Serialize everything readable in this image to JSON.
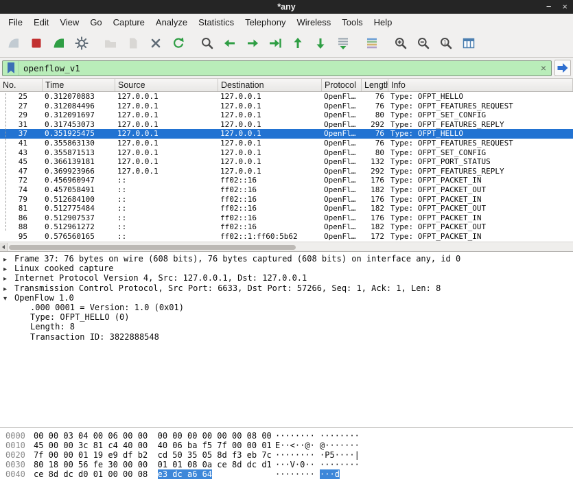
{
  "window": {
    "title": "*any",
    "minimize_glyph": "−",
    "close_glyph": "×"
  },
  "colors": {
    "accent_selection": "#2273d2",
    "hex_highlight": "#3d87d9",
    "filter_valid_green": "#b9edb9",
    "titlebar_bg": "#252525",
    "stop_red": "#c23030",
    "nav_green": "#2f9e44"
  },
  "menu": {
    "items": [
      "File",
      "Edit",
      "View",
      "Go",
      "Capture",
      "Analyze",
      "Statistics",
      "Telephony",
      "Wireless",
      "Tools",
      "Help"
    ]
  },
  "toolbar": {
    "buttons": [
      {
        "name": "capture-start",
        "icon": "fin",
        "color": "#7e96a8",
        "disabled": true
      },
      {
        "name": "capture-stop",
        "icon": "square",
        "color": "#c23030",
        "disabled": false
      },
      {
        "name": "capture-restart",
        "icon": "fin",
        "color": "#2f9e44",
        "disabled": false
      },
      {
        "name": "capture-options",
        "icon": "gear",
        "color": "#5f6b76",
        "disabled": false
      },
      {
        "sep": true
      },
      {
        "name": "open-file",
        "icon": "folder",
        "color": "#b7b3ad",
        "disabled": true
      },
      {
        "name": "save-file",
        "icon": "doc",
        "color": "#b7b3ad",
        "disabled": true
      },
      {
        "name": "close-file",
        "icon": "close",
        "color": "#5f6b76",
        "disabled": false
      },
      {
        "name": "reload-file",
        "icon": "reload",
        "color": "#2f9e44",
        "disabled": false
      },
      {
        "sep": true
      },
      {
        "name": "find-packet",
        "icon": "magnifier",
        "color": "#4a4a4a",
        "disabled": false
      },
      {
        "name": "go-back",
        "icon": "arrow-left",
        "color": "#2f9e44",
        "disabled": false
      },
      {
        "name": "go-forward",
        "icon": "arrow-right",
        "color": "#2f9e44",
        "disabled": false
      },
      {
        "name": "go-to-packet",
        "icon": "goto",
        "color": "#2f9e44",
        "disabled": false
      },
      {
        "name": "go-first",
        "icon": "arrow-top",
        "color": "#2f9e44",
        "disabled": false
      },
      {
        "name": "go-last",
        "icon": "arrow-bottom",
        "color": "#2f9e44",
        "disabled": false
      },
      {
        "name": "auto-scroll",
        "icon": "autoscroll",
        "color": "#2f9e44",
        "disabled": false
      },
      {
        "sep": true
      },
      {
        "name": "colorize",
        "icon": "colorize",
        "color": "#7a8ea0",
        "disabled": false
      },
      {
        "sep": true
      },
      {
        "name": "zoom-in",
        "icon": "zoom-in",
        "color": "#4a4a4a",
        "disabled": false
      },
      {
        "name": "zoom-out",
        "icon": "zoom-out",
        "color": "#4a4a4a",
        "disabled": false
      },
      {
        "name": "zoom-original",
        "icon": "zoom-orig",
        "color": "#4a4a4a",
        "disabled": false
      },
      {
        "name": "resize-columns",
        "icon": "columns",
        "color": "#4c7fb0",
        "disabled": false
      }
    ]
  },
  "filter": {
    "value": "openflow_v1",
    "clear_glyph": "×"
  },
  "packet_list": {
    "columns": [
      "No.",
      "Time",
      "Source",
      "Destination",
      "Protocol",
      "Length",
      "Info"
    ],
    "rows": [
      {
        "no": "25",
        "time": "0.312070883",
        "src": "127.0.0.1",
        "dst": "127.0.0.1",
        "proto": "OpenFl…",
        "len": "76",
        "info": "Type: OFPT_HELLO",
        "selected": false
      },
      {
        "no": "27",
        "time": "0.312084496",
        "src": "127.0.0.1",
        "dst": "127.0.0.1",
        "proto": "OpenFl…",
        "len": "76",
        "info": "Type: OFPT_FEATURES_REQUEST",
        "selected": false
      },
      {
        "no": "29",
        "time": "0.312091697",
        "src": "127.0.0.1",
        "dst": "127.0.0.1",
        "proto": "OpenFl…",
        "len": "80",
        "info": "Type: OFPT_SET_CONFIG",
        "selected": false
      },
      {
        "no": "31",
        "time": "0.317453073",
        "src": "127.0.0.1",
        "dst": "127.0.0.1",
        "proto": "OpenFl…",
        "len": "292",
        "info": "Type: OFPT_FEATURES_REPLY",
        "selected": false
      },
      {
        "no": "37",
        "time": "0.351925475",
        "src": "127.0.0.1",
        "dst": "127.0.0.1",
        "proto": "OpenFl…",
        "len": "76",
        "info": "Type: OFPT_HELLO",
        "selected": true
      },
      {
        "no": "41",
        "time": "0.355863130",
        "src": "127.0.0.1",
        "dst": "127.0.0.1",
        "proto": "OpenFl…",
        "len": "76",
        "info": "Type: OFPT_FEATURES_REQUEST",
        "selected": false
      },
      {
        "no": "43",
        "time": "0.355871513",
        "src": "127.0.0.1",
        "dst": "127.0.0.1",
        "proto": "OpenFl…",
        "len": "80",
        "info": "Type: OFPT_SET_CONFIG",
        "selected": false
      },
      {
        "no": "45",
        "time": "0.366139181",
        "src": "127.0.0.1",
        "dst": "127.0.0.1",
        "proto": "OpenFl…",
        "len": "132",
        "info": "Type: OFPT_PORT_STATUS",
        "selected": false
      },
      {
        "no": "47",
        "time": "0.369923966",
        "src": "127.0.0.1",
        "dst": "127.0.0.1",
        "proto": "OpenFl…",
        "len": "292",
        "info": "Type: OFPT_FEATURES_REPLY",
        "selected": false
      },
      {
        "no": "72",
        "time": "0.456960947",
        "src": "::",
        "dst": "ff02::16",
        "proto": "OpenFl…",
        "len": "176",
        "info": "Type: OFPT_PACKET_IN",
        "selected": false
      },
      {
        "no": "74",
        "time": "0.457058491",
        "src": "::",
        "dst": "ff02::16",
        "proto": "OpenFl…",
        "len": "182",
        "info": "Type: OFPT_PACKET_OUT",
        "selected": false
      },
      {
        "no": "79",
        "time": "0.512684100",
        "src": "::",
        "dst": "ff02::16",
        "proto": "OpenFl…",
        "len": "176",
        "info": "Type: OFPT_PACKET_IN",
        "selected": false
      },
      {
        "no": "81",
        "time": "0.512775484",
        "src": "::",
        "dst": "ff02::16",
        "proto": "OpenFl…",
        "len": "182",
        "info": "Type: OFPT_PACKET_OUT",
        "selected": false
      },
      {
        "no": "86",
        "time": "0.512907537",
        "src": "::",
        "dst": "ff02::16",
        "proto": "OpenFl…",
        "len": "176",
        "info": "Type: OFPT_PACKET_IN",
        "selected": false
      },
      {
        "no": "88",
        "time": "0.512961272",
        "src": "::",
        "dst": "ff02::16",
        "proto": "OpenFl…",
        "len": "182",
        "info": "Type: OFPT_PACKET_OUT",
        "selected": false
      },
      {
        "no": "95",
        "time": "0.576560165",
        "src": "::",
        "dst": "ff02::1:ff60:5b62",
        "proto": "OpenFl…",
        "len": "172",
        "info": "Type: OFPT_PACKET_IN",
        "selected": false
      }
    ]
  },
  "details": {
    "lines": [
      {
        "expander": "▸",
        "indent": 0,
        "text": "Frame 37: 76 bytes on wire (608 bits), 76 bytes captured (608 bits) on interface any, id 0"
      },
      {
        "expander": "▸",
        "indent": 0,
        "text": "Linux cooked capture"
      },
      {
        "expander": "▸",
        "indent": 0,
        "text": "Internet Protocol Version 4, Src: 127.0.0.1, Dst: 127.0.0.1"
      },
      {
        "expander": "▸",
        "indent": 0,
        "text": "Transmission Control Protocol, Src Port: 6633, Dst Port: 57266, Seq: 1, Ack: 1, Len: 8"
      },
      {
        "expander": "▾",
        "indent": 0,
        "text": "OpenFlow 1.0"
      },
      {
        "expander": null,
        "indent": 1,
        "text": ".000 0001 = Version: 1.0 (0x01)"
      },
      {
        "expander": null,
        "indent": 1,
        "text": "Type: OFPT_HELLO (0)"
      },
      {
        "expander": null,
        "indent": 1,
        "text": "Length: 8"
      },
      {
        "expander": null,
        "indent": 1,
        "text": "Transaction ID: 3822888548"
      }
    ]
  },
  "hex": {
    "rows": [
      {
        "offset": "0000",
        "hex": "00 00 03 04 00 06 00 00  00 00 00 00 00 00 08 00",
        "hex_hl": "",
        "ascii": "········ ········",
        "ascii_hl": ""
      },
      {
        "offset": "0010",
        "hex": "45 00 00 3c 81 c4 40 00  40 06 ba f5 7f 00 00 01",
        "hex_hl": "",
        "ascii": "E··<··@· @·······",
        "ascii_hl": ""
      },
      {
        "offset": "0020",
        "hex": "7f 00 00 01 19 e9 df b2  cd 50 35 05 8d f3 eb 7c",
        "hex_hl": "",
        "ascii": "········ ·P5····|",
        "ascii_hl": ""
      },
      {
        "offset": "0030",
        "hex": "80 18 00 56 fe 30 00 00  01 01 08 0a ce 8d dc d1",
        "hex_hl": "",
        "ascii": "···V·0·· ········",
        "ascii_hl": ""
      },
      {
        "offset": "0040",
        "hex": "ce 8d dc d0 01 00 00 08  ",
        "hex_hl": "e3 dc a6 64",
        "ascii": "········ ",
        "ascii_hl": "···d"
      }
    ]
  }
}
